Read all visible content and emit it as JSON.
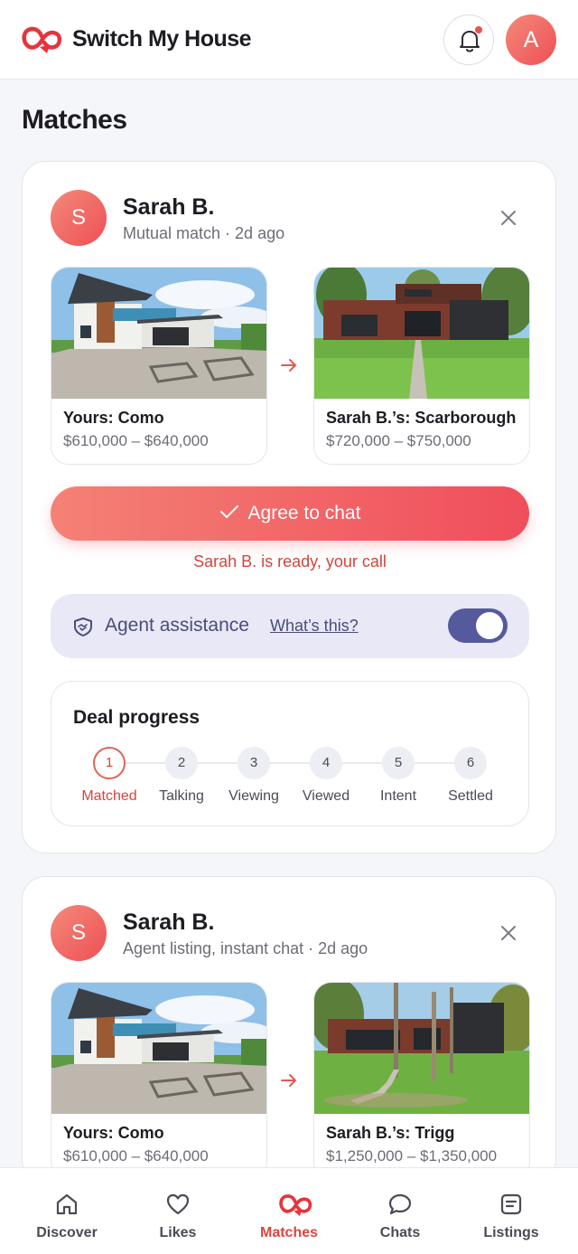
{
  "header": {
    "brand": "Switch My House",
    "user_initial": "A"
  },
  "page_title": "Matches",
  "matches": [
    {
      "initial": "S",
      "name": "Sarah B.",
      "subtitle": "Mutual match · 2d ago",
      "yours": {
        "title": "Yours: Como",
        "price": "$610,000 – $640,000"
      },
      "theirs": {
        "title": "Sarah B.’s: Scarborough",
        "price": "$720,000 – $750,000"
      },
      "agree_label": "Agree to chat",
      "ready_text": "Sarah B. is ready, your call",
      "agent_label": "Agent assistance",
      "agent_link": "What’s this?",
      "agent_assistance_on": true,
      "progress_title": "Deal progress",
      "steps": [
        {
          "num": "1",
          "label": "Matched"
        },
        {
          "num": "2",
          "label": "Talking"
        },
        {
          "num": "3",
          "label": "Viewing"
        },
        {
          "num": "4",
          "label": "Viewed"
        },
        {
          "num": "5",
          "label": "Intent"
        },
        {
          "num": "6",
          "label": "Settled"
        }
      ]
    },
    {
      "initial": "S",
      "name": "Sarah B.",
      "subtitle": "Agent listing, instant chat · 2d ago",
      "yours": {
        "title": "Yours: Como",
        "price": "$610,000 – $640,000"
      },
      "theirs": {
        "title": "Sarah B.’s: Trigg",
        "price": "$1,250,000 – $1,350,000"
      }
    }
  ],
  "nav": [
    {
      "label": "Discover",
      "icon": "home-icon"
    },
    {
      "label": "Likes",
      "icon": "heart-icon"
    },
    {
      "label": "Matches",
      "icon": "matches-logo-icon",
      "active": true
    },
    {
      "label": "Chats",
      "icon": "chat-bubble-icon"
    },
    {
      "label": "Listings",
      "icon": "listings-icon"
    }
  ],
  "colors": {
    "accent": "#f04e5b",
    "toggle_on": "#545a9c",
    "agent_bg": "#e8e8f7"
  }
}
